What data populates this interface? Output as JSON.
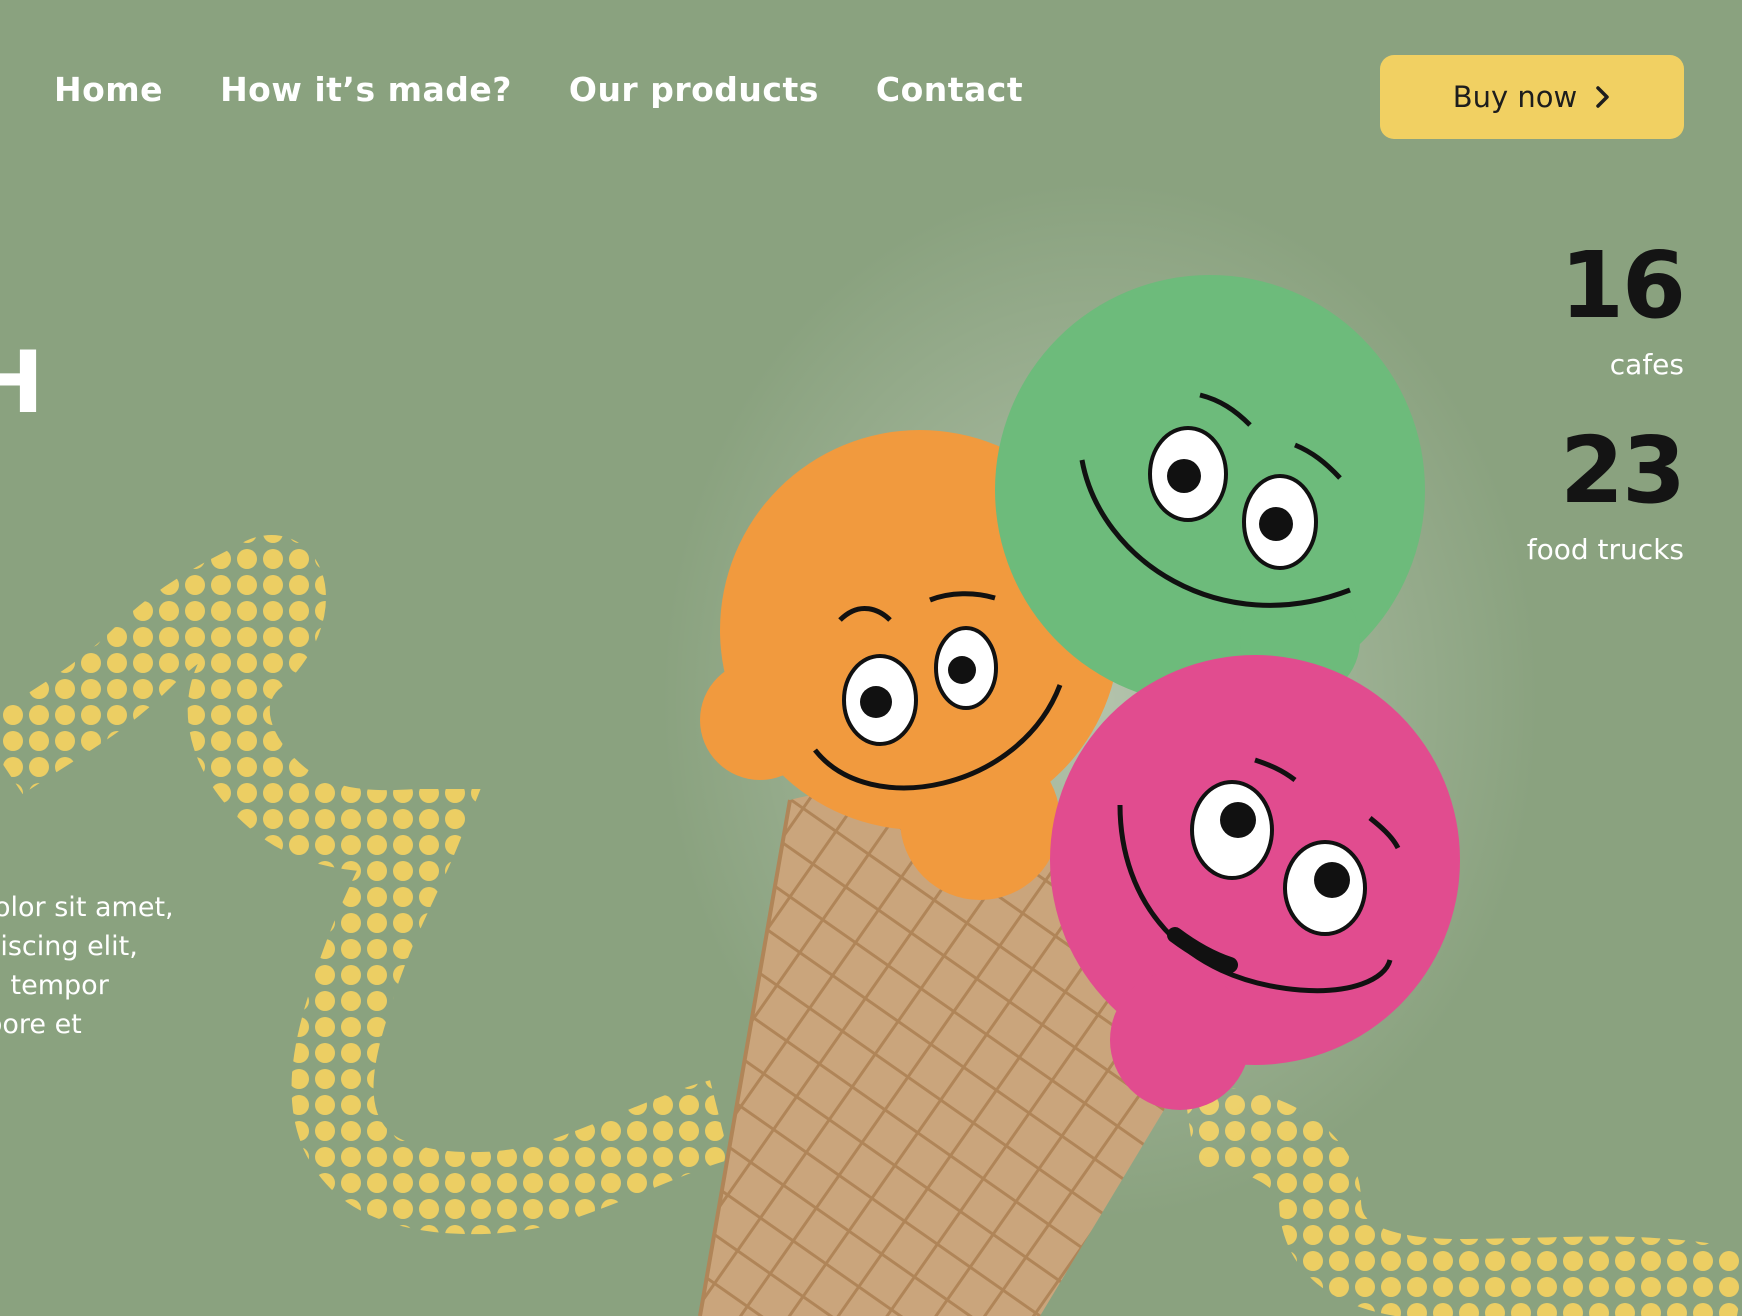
{
  "nav": {
    "items": [
      {
        "label": "Home"
      },
      {
        "label": "How it’s made?"
      },
      {
        "label": "Our products"
      },
      {
        "label": "Contact"
      }
    ]
  },
  "cta": {
    "label": "Buy now",
    "icon": "chevron-right-icon",
    "color": "#f1d062"
  },
  "hero": {
    "partial_heading": "H",
    "description": "m dolor sit amet,\n adipiscing elit,\nmod tempor\nt labore et"
  },
  "stats": [
    {
      "value": "16",
      "label": "cafes"
    },
    {
      "value": "23",
      "label": "food trucks"
    }
  ],
  "theme": {
    "background": "#8aa27f",
    "dots": "#f1d062"
  },
  "image": {
    "subject": "ice-cream-cone-icon"
  }
}
